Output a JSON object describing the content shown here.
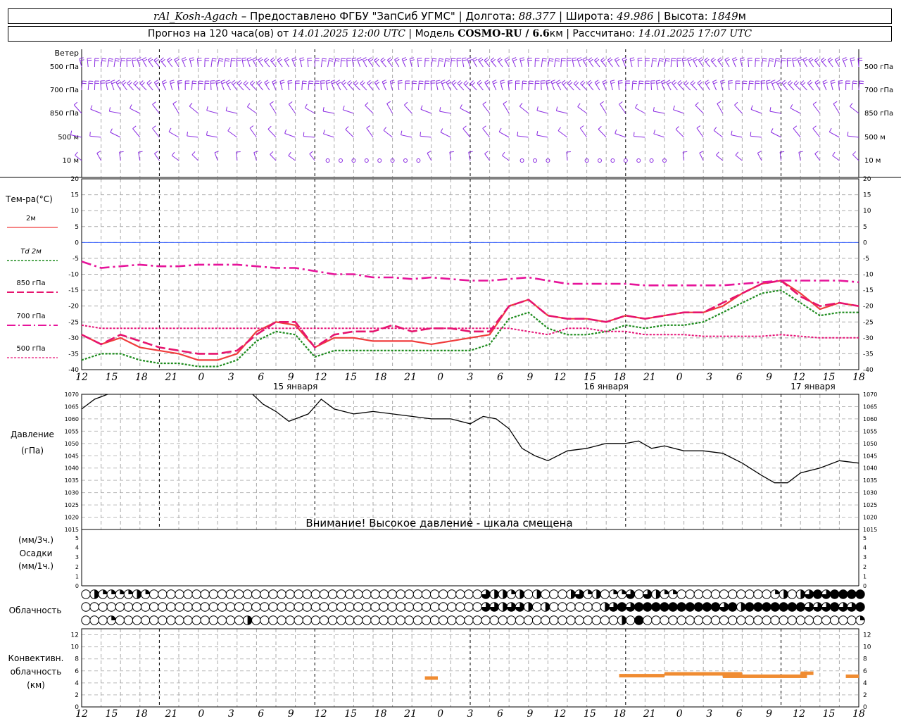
{
  "header": {
    "station": "rAl_Kosh-Agach",
    "provider": " – Предоставлено ФГБУ \"ЗапСиб УГМС\" | Долгота: ",
    "lon": "88.377",
    "lat_label": " | Широта: ",
    "lat": "49.986",
    "alt_label": " | Высота: ",
    "alt": "1849",
    "alt_unit": "м",
    "forecast_label": "Прогноз на 120 часа(ов) от ",
    "forecast_time": "14.01.2025 12:00 UTC",
    "model_label": " | Модель ",
    "model": "COSMO-RU / 6.6",
    "model_unit": "км",
    "calc_label": " | Рассчитано: ",
    "calc_time": "14.01.2025 17:07 UTC"
  },
  "labels": {
    "wind_title": "Ветер",
    "wind_levels": [
      "500 гПа",
      "700 гПа",
      "850 гПа",
      "500 м",
      "10 м"
    ],
    "temp_title": "Тем-ра(°C)",
    "legend": [
      "2м",
      "Td 2м",
      "850 гПа",
      "700 гПа",
      "500 гПа"
    ],
    "pressure_title": "Давление",
    "pressure_unit": "(гПа)",
    "pressure_warning": "Внимание! Высокое давление - шкала смещена",
    "precip_unit_top": "(мм/3ч.)",
    "precip_title": "Осадки",
    "precip_unit_bottom": "(мм/1ч.)",
    "cloud_title": "Облачность",
    "conv_title": [
      "Конвективн.",
      "облачность",
      "(км)"
    ],
    "hour_ticks": [
      "12",
      "15",
      "18",
      "21",
      "0",
      "3",
      "6",
      "9",
      "12",
      "15",
      "18",
      "21",
      "0",
      "3",
      "6",
      "9",
      "12",
      "15",
      "18",
      "21",
      "0",
      "3",
      "6",
      "9",
      "12",
      "15",
      "18"
    ],
    "dates": [
      "15 января",
      "16 января",
      "17 января"
    ]
  },
  "colors": {
    "t2m": "#f03c3c",
    "td2m": "#1e8c1e",
    "t850": "#e6146e",
    "t700": "#e6149a",
    "t500": "#e61478",
    "wind": "#8a2be2",
    "pressure": "#000000",
    "conv": "#f08c32",
    "zero_line": "#3c64ff"
  },
  "chart_data": [
    {
      "type": "line",
      "title": "Тем-ра(°C)",
      "x_unit": "hours since forecast start",
      "ylim": [
        -40,
        20
      ],
      "yticks": [
        20,
        15,
        10,
        5,
        0,
        -5,
        -10,
        -15,
        -20,
        -25,
        -30,
        -35,
        -40
      ],
      "series": [
        {
          "name": "2м",
          "x": [
            0,
            3,
            6,
            9,
            12,
            15,
            18,
            21,
            24,
            27,
            30,
            33,
            36,
            39,
            42,
            45,
            48,
            51,
            54,
            57,
            60,
            63,
            66,
            69,
            72,
            75,
            78,
            81,
            84,
            87,
            90,
            93,
            96,
            99,
            102,
            105,
            108,
            111,
            114,
            117,
            120
          ],
          "values": [
            -29,
            -32,
            -30,
            -33,
            -34,
            -35,
            -37,
            -37,
            -35,
            -28,
            -25,
            -26,
            -33,
            -30,
            -30,
            -31,
            -31,
            -31,
            -32,
            -31,
            -30,
            -29,
            -20,
            -18,
            -23,
            -24,
            -24,
            -25,
            -23,
            -24,
            -23,
            -22,
            -22,
            -20,
            -16,
            -13,
            -12,
            -16,
            -21,
            -19,
            -20
          ]
        },
        {
          "name": "Td 2м",
          "x": [
            0,
            3,
            6,
            9,
            12,
            15,
            18,
            21,
            24,
            27,
            30,
            33,
            36,
            39,
            42,
            45,
            48,
            51,
            54,
            57,
            60,
            63,
            66,
            69,
            72,
            75,
            78,
            81,
            84,
            87,
            90,
            93,
            96,
            99,
            102,
            105,
            108,
            111,
            114,
            117,
            120
          ],
          "values": [
            -37,
            -35,
            -35,
            -37,
            -38,
            -38,
            -39,
            -39,
            -37,
            -31,
            -28,
            -29,
            -36,
            -34,
            -34,
            -34,
            -34,
            -34,
            -34,
            -34,
            -34,
            -32,
            -24,
            -22,
            -27,
            -29,
            -29,
            -28,
            -26,
            -27,
            -26,
            -26,
            -25,
            -22,
            -19,
            -16,
            -15,
            -19,
            -23,
            -22,
            -22
          ]
        },
        {
          "name": "850 гПа",
          "x": [
            0,
            3,
            6,
            9,
            12,
            15,
            18,
            21,
            24,
            27,
            30,
            33,
            36,
            39,
            42,
            45,
            48,
            51,
            54,
            57,
            60,
            63,
            66,
            69,
            72,
            75,
            78,
            81,
            84,
            87,
            90,
            93,
            96,
            99,
            102,
            105,
            108,
            111,
            114,
            117,
            120
          ],
          "values": [
            -29,
            -32,
            -29,
            -31,
            -33,
            -34,
            -35,
            -35,
            -34,
            -29,
            -25,
            -25,
            -33,
            -29,
            -28,
            -28,
            -26,
            -28,
            -27,
            -27,
            -28,
            -28,
            -20,
            -18,
            -23,
            -24,
            -24,
            -25,
            -23,
            -24,
            -23,
            -22,
            -22,
            -19,
            -16,
            -13,
            -12,
            -17,
            -20,
            -19,
            -20
          ]
        },
        {
          "name": "700 гПа",
          "x": [
            0,
            3,
            6,
            9,
            12,
            15,
            18,
            21,
            24,
            27,
            30,
            33,
            36,
            39,
            42,
            45,
            48,
            51,
            54,
            57,
            60,
            63,
            66,
            69,
            72,
            75,
            78,
            81,
            84,
            87,
            90,
            93,
            96,
            99,
            102,
            105,
            108,
            111,
            114,
            117,
            120
          ],
          "values": [
            -6,
            -8,
            -7.5,
            -7,
            -7.5,
            -7.5,
            -7,
            -7,
            -7,
            -7.5,
            -8,
            -8,
            -9,
            -10,
            -10,
            -11,
            -11,
            -11.5,
            -11,
            -11.5,
            -12,
            -12,
            -11.5,
            -11,
            -12,
            -13,
            -13,
            -13,
            -13,
            -13.5,
            -13.5,
            -13.5,
            -13.5,
            -13.5,
            -13,
            -12.5,
            -12,
            -12,
            -12,
            -12,
            -12.5
          ]
        },
        {
          "name": "500 гПа",
          "x": [
            0,
            3,
            6,
            9,
            12,
            15,
            18,
            21,
            24,
            27,
            30,
            33,
            36,
            39,
            42,
            45,
            48,
            51,
            54,
            57,
            60,
            63,
            66,
            69,
            72,
            75,
            78,
            81,
            84,
            87,
            90,
            93,
            96,
            99,
            102,
            105,
            108,
            111,
            114,
            117,
            120
          ],
          "values": [
            -26,
            -27,
            -27,
            -27,
            -27,
            -27,
            -27,
            -27,
            -27,
            -27,
            -27,
            -27,
            -27,
            -27,
            -27,
            -27,
            -27,
            -27,
            -27,
            -27,
            -27,
            -27,
            -27,
            -28,
            -29,
            -27,
            -27,
            -28,
            -28,
            -29,
            -29,
            -29,
            -29.5,
            -29.5,
            -29.5,
            -29.5,
            -29,
            -29.5,
            -30,
            -30,
            -30
          ]
        }
      ]
    },
    {
      "type": "line",
      "title": "Давление",
      "x_unit": "hours since forecast start",
      "ylim": [
        1015,
        1070
      ],
      "yticks": [
        1070,
        1065,
        1060,
        1055,
        1050,
        1045,
        1040,
        1035,
        1030,
        1025,
        1020,
        1015
      ],
      "series": [
        {
          "name": "Давление",
          "x": [
            0,
            2,
            4,
            6,
            9,
            12,
            15,
            18,
            21,
            24,
            26,
            28,
            30,
            32,
            35,
            37,
            39,
            42,
            45,
            48,
            51,
            54,
            57,
            60,
            62,
            64,
            66,
            68,
            70,
            72,
            75,
            78,
            81,
            84,
            86,
            88,
            90,
            93,
            96,
            99,
            102,
            105,
            107,
            109,
            111,
            114,
            117,
            120
          ],
          "values": [
            1064,
            1068,
            1070,
            1072,
            1074,
            1075,
            1075,
            1074,
            1073,
            1073,
            1071,
            1066,
            1063,
            1059,
            1062,
            1068,
            1064,
            1062,
            1063,
            1062,
            1061,
            1060,
            1060,
            1058,
            1061,
            1060,
            1056,
            1048,
            1045,
            1043,
            1047,
            1048,
            1050,
            1050,
            1051,
            1048,
            1049,
            1047,
            1047,
            1046,
            1042,
            1037,
            1034,
            1034,
            1038,
            1040,
            1043,
            1042
          ]
        }
      ]
    },
    {
      "type": "bar",
      "title": "Осадки",
      "ylim": [
        0,
        5
      ],
      "yticks": [
        5,
        4,
        3,
        2,
        1,
        0
      ],
      "values": []
    },
    {
      "type": "table",
      "title": "Облачность",
      "rows": [
        [
          0,
          2,
          1,
          1,
          1,
          1,
          2,
          1,
          0,
          0,
          0,
          0,
          0,
          0,
          0,
          0,
          0,
          0,
          0,
          0,
          0,
          0,
          0,
          0,
          0,
          0,
          0,
          0,
          0,
          0,
          0,
          0,
          0,
          0,
          0,
          0,
          0,
          0,
          0,
          0,
          0,
          0,
          0,
          0,
          0,
          0,
          0,
          3,
          2,
          2,
          1,
          2,
          0,
          2,
          0,
          0,
          0,
          2,
          3,
          1,
          2,
          0,
          1,
          1,
          3,
          0,
          3,
          2,
          1,
          1,
          0,
          0,
          0,
          0,
          0,
          0,
          0,
          0,
          0,
          0,
          0,
          1,
          2,
          0,
          2,
          3,
          4,
          3,
          4,
          4,
          4,
          4
        ],
        [
          0,
          0,
          0,
          0,
          0,
          0,
          0,
          0,
          0,
          0,
          0,
          0,
          0,
          0,
          0,
          0,
          0,
          0,
          0,
          0,
          0,
          0,
          0,
          0,
          0,
          0,
          0,
          0,
          0,
          0,
          0,
          0,
          0,
          0,
          0,
          0,
          0,
          0,
          0,
          0,
          0,
          0,
          0,
          0,
          0,
          0,
          0,
          3,
          3,
          2,
          3,
          3,
          2,
          0,
          2,
          0,
          0,
          0,
          0,
          0,
          0,
          2,
          3,
          4,
          3,
          4,
          4,
          4,
          4,
          4,
          4,
          4,
          4,
          4,
          4,
          3,
          4,
          2,
          4,
          4,
          4,
          4,
          4,
          4,
          4,
          3,
          3,
          3,
          4,
          3,
          3,
          4
        ],
        [
          0,
          0,
          0,
          1,
          0,
          0,
          0,
          0,
          0,
          0,
          0,
          0,
          0,
          0,
          0,
          0,
          0,
          0,
          0,
          2,
          0,
          0,
          0,
          0,
          0,
          0,
          0,
          0,
          0,
          0,
          0,
          0,
          0,
          0,
          0,
          0,
          0,
          0,
          0,
          0,
          0,
          0,
          0,
          0,
          0,
          0,
          0,
          0,
          0,
          0,
          0,
          0,
          0,
          0,
          0,
          0,
          0,
          0,
          0,
          0,
          0,
          0,
          0,
          2,
          0,
          4,
          0,
          0,
          0,
          0,
          0,
          0,
          0,
          0,
          0,
          0,
          0,
          0,
          0,
          0,
          0,
          0,
          0,
          0,
          0,
          0,
          0,
          0,
          0,
          0,
          0,
          1
        ]
      ]
    },
    {
      "type": "bar",
      "title": "Конвективн. облачность (км)",
      "ylim": [
        0,
        13
      ],
      "yticks": [
        12,
        10,
        8,
        6,
        4,
        2,
        0
      ],
      "segments": [
        {
          "x_start": 53,
          "x_end": 55,
          "height_km": 4.8
        },
        {
          "x_start": 83,
          "x_end": 90,
          "height_km": 5.2
        },
        {
          "x_start": 90,
          "x_end": 102,
          "height_km": 5.5
        },
        {
          "x_start": 99,
          "x_end": 112,
          "height_km": 5.1
        },
        {
          "x_start": 111,
          "x_end": 113,
          "height_km": 5.6
        },
        {
          "x_start": 118,
          "x_end": 120,
          "height_km": 5.1
        }
      ]
    }
  ]
}
